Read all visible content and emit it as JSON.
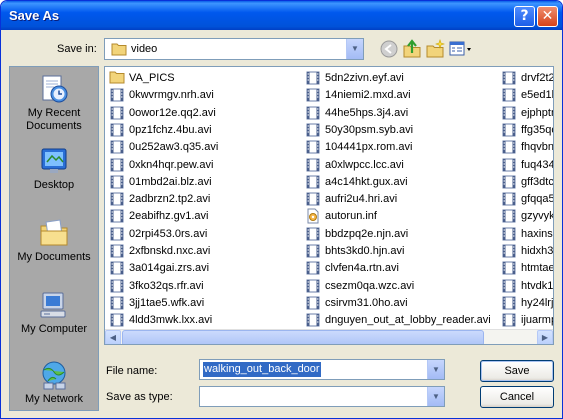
{
  "window": {
    "title": "Save As",
    "help_label": "?",
    "close_label": "✕"
  },
  "toolbar": {
    "save_in_label": "Save in:",
    "save_in_value": "video",
    "icons": [
      "back-icon",
      "up-folder-icon",
      "new-folder-icon",
      "views-menu-icon"
    ]
  },
  "places": [
    {
      "label": "My Recent Documents",
      "icon": "recent-documents-icon"
    },
    {
      "label": "Desktop",
      "icon": "desktop-icon"
    },
    {
      "label": "My Documents",
      "icon": "my-documents-icon"
    },
    {
      "label": "My Computer",
      "icon": "my-computer-icon"
    },
    {
      "label": "My Network",
      "icon": "my-network-icon"
    }
  ],
  "files": {
    "column1": [
      {
        "name": "VA_PICS",
        "type": "folder"
      },
      {
        "name": "0kwvrmgv.nrh.avi",
        "type": "video"
      },
      {
        "name": "0owor12e.qq2.avi",
        "type": "video"
      },
      {
        "name": "0pz1fchz.4bu.avi",
        "type": "video"
      },
      {
        "name": "0u252aw3.q35.avi",
        "type": "video"
      },
      {
        "name": "0xkn4hqr.pew.avi",
        "type": "video"
      },
      {
        "name": "01mbd2ai.blz.avi",
        "type": "video"
      },
      {
        "name": "2adbrzn2.tp2.avi",
        "type": "video"
      },
      {
        "name": "2eabifhz.gv1.avi",
        "type": "video"
      },
      {
        "name": "02rpi453.0rs.avi",
        "type": "video"
      },
      {
        "name": "2xfbnskd.nxc.avi",
        "type": "video"
      },
      {
        "name": "3a014gai.zrs.avi",
        "type": "video"
      },
      {
        "name": "3fko32qs.rfr.avi",
        "type": "video"
      },
      {
        "name": "3jj1tae5.wfk.avi",
        "type": "video"
      },
      {
        "name": "4ldd3mwk.lxx.avi",
        "type": "video"
      }
    ],
    "column2": [
      {
        "name": "5dn2zivn.eyf.avi",
        "type": "video"
      },
      {
        "name": "14niemi2.mxd.avi",
        "type": "video"
      },
      {
        "name": "44he5hps.3j4.avi",
        "type": "video"
      },
      {
        "name": "50y30psm.syb.avi",
        "type": "video"
      },
      {
        "name": "104441px.rom.avi",
        "type": "video"
      },
      {
        "name": "a0xlwpcc.lcc.avi",
        "type": "video"
      },
      {
        "name": "a4c14hkt.gux.avi",
        "type": "video"
      },
      {
        "name": "aufri2u4.hri.avi",
        "type": "video"
      },
      {
        "name": "autorun.inf",
        "type": "inf"
      },
      {
        "name": "bbdzpq2e.njn.avi",
        "type": "video"
      },
      {
        "name": "bhts3kd0.hjn.avi",
        "type": "video"
      },
      {
        "name": "clvfen4a.rtn.avi",
        "type": "video"
      },
      {
        "name": "csezm0qa.wzc.avi",
        "type": "video"
      },
      {
        "name": "csirvm31.0ho.avi",
        "type": "video"
      },
      {
        "name": "dnguyen_out_at_lobby_reader.avi",
        "type": "video"
      }
    ],
    "column3": [
      {
        "name": "drvf2t2",
        "type": "video"
      },
      {
        "name": "e5ed1b",
        "type": "video"
      },
      {
        "name": "ejphptn",
        "type": "video"
      },
      {
        "name": "ffg35qc",
        "type": "video"
      },
      {
        "name": "fhqvbnz",
        "type": "video"
      },
      {
        "name": "fuq434b",
        "type": "video"
      },
      {
        "name": "gff3dtc",
        "type": "video"
      },
      {
        "name": "gfqqa5r",
        "type": "video"
      },
      {
        "name": "gzyvykj",
        "type": "video"
      },
      {
        "name": "haxinse",
        "type": "video"
      },
      {
        "name": "hidxh3i",
        "type": "video"
      },
      {
        "name": "htmtaei",
        "type": "video"
      },
      {
        "name": "htvdk1y",
        "type": "video"
      },
      {
        "name": "hy24lrjx",
        "type": "video"
      },
      {
        "name": "ijuarmp",
        "type": "video"
      }
    ]
  },
  "form": {
    "file_name_label": "File name:",
    "file_name_value": "walking_out_back_door",
    "save_as_type_label": "Save as type:",
    "save_as_type_value": "",
    "save_button": "Save",
    "cancel_button": "Cancel"
  }
}
